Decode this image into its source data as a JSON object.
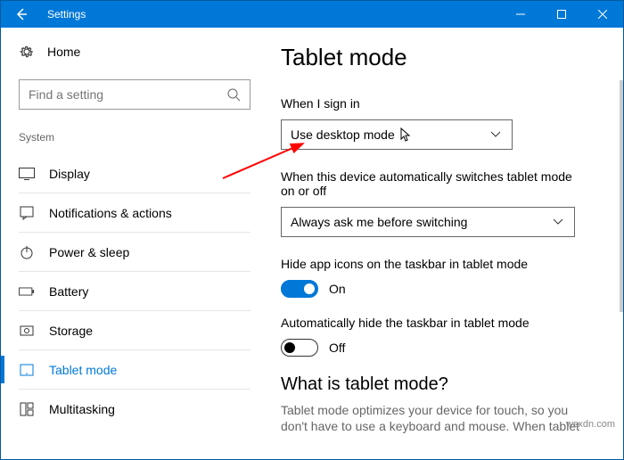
{
  "titlebar": {
    "title": "Settings"
  },
  "sidebar": {
    "home": "Home",
    "search_placeholder": "Find a setting",
    "section": "System",
    "items": [
      {
        "label": "Display"
      },
      {
        "label": "Notifications & actions"
      },
      {
        "label": "Power & sleep"
      },
      {
        "label": "Battery"
      },
      {
        "label": "Storage"
      },
      {
        "label": "Tablet mode"
      },
      {
        "label": "Multitasking"
      }
    ]
  },
  "main": {
    "title": "Tablet mode",
    "signin_label": "When I sign in",
    "signin_value": "Use desktop mode",
    "switch_label": "When this device automatically switches tablet mode on or off",
    "switch_value": "Always ask me before switching",
    "hide_icons_label": "Hide app icons on the taskbar in tablet mode",
    "hide_icons_value": "On",
    "auto_hide_label": "Automatically hide the taskbar in tablet mode",
    "auto_hide_value": "Off",
    "what_heading": "What is tablet mode?",
    "what_desc": "Tablet mode optimizes your device for touch, so you don't have to use a keyboard and mouse. When tablet"
  },
  "annotation": {
    "watermark": "wsxdn.com"
  }
}
